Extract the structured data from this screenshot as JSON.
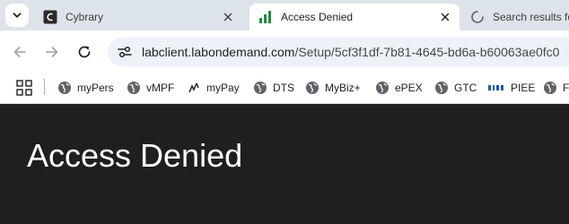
{
  "tabs": [
    {
      "title": "Cybrary",
      "icon": "cybrary-favicon"
    },
    {
      "title": "Access Denied",
      "icon": "bar-chart-favicon"
    },
    {
      "title": "Search results fo",
      "icon": "loading-favicon"
    }
  ],
  "toolbar": {
    "url_host": "labclient.labondemand.com",
    "url_path": "/Setup/5cf3f1df-7b81-4645-bd6a-b60063ae0fc0"
  },
  "bookmarks": [
    {
      "label": "myPers",
      "icon": "globe-icon"
    },
    {
      "label": "vMPF",
      "icon": "globe-icon"
    },
    {
      "label": "myPay",
      "icon": "mypay-icon"
    },
    {
      "label": "DTS",
      "icon": "globe-icon"
    },
    {
      "label": "MyBiz+",
      "icon": "globe-icon"
    },
    {
      "label": "ePEX",
      "icon": "globe-icon"
    },
    {
      "label": "GTC",
      "icon": "globe-icon"
    },
    {
      "label": "PIEE",
      "icon": "piee-icon"
    },
    {
      "label": "Fa",
      "icon": "globe-icon"
    }
  ],
  "page": {
    "heading": "Access Denied"
  },
  "colors": {
    "tabstrip": "#dde3ea",
    "omnibox": "#edf2fa",
    "content_bg": "#1f1f1f",
    "heading": "#ffffff",
    "active_favicon": "#1e8e3e"
  }
}
